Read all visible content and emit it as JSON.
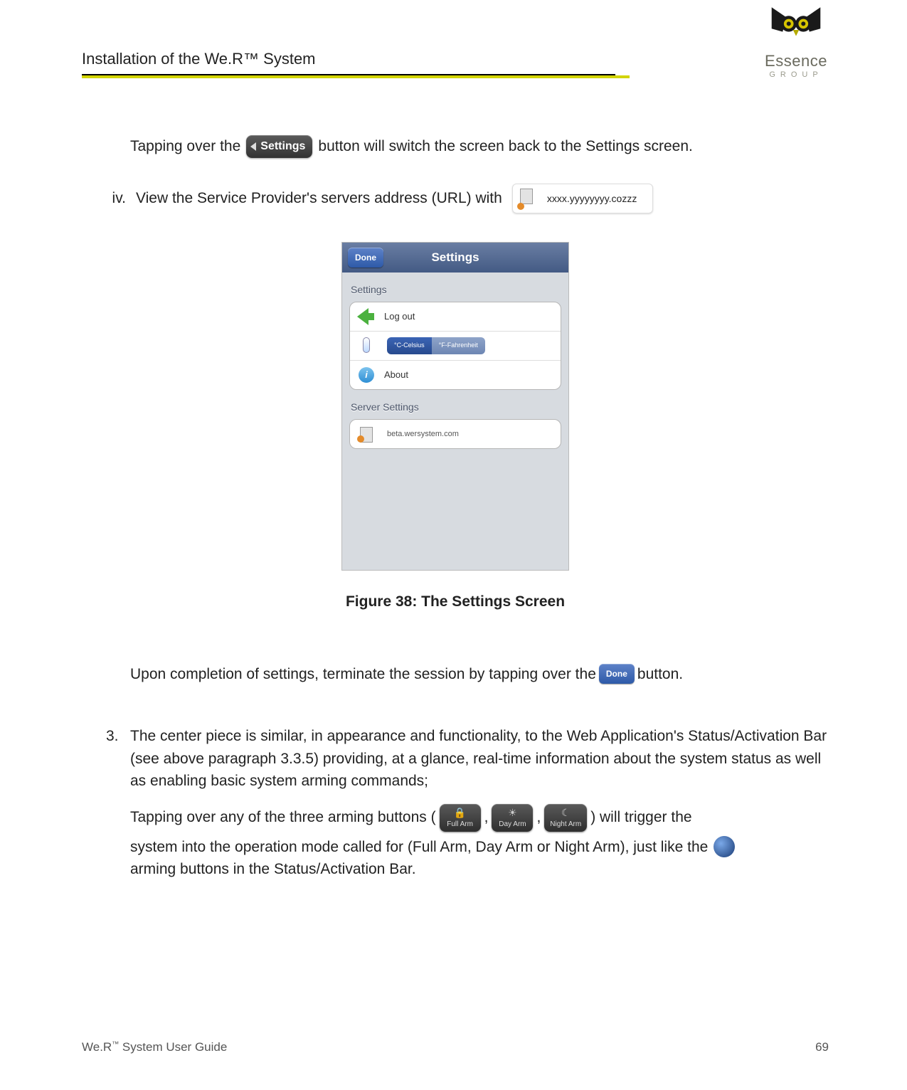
{
  "header": {
    "title": "Installation of the We.R™ System",
    "logo_text": "Essence",
    "logo_sub": "GROUP"
  },
  "body": {
    "line1_a": "Tapping over the",
    "settings_pill": "Settings",
    "line1_b": "button will switch the screen back to the Settings screen.",
    "iv_label": "iv.",
    "iv_text": "View the Service Provider's servers address (URL) with",
    "url_chip": "xxxx.yyyyyyyy.cozzz",
    "figure_caption": "Figure 38: The Settings Screen",
    "upon_a": "Upon completion of settings, terminate the session by tapping over the",
    "done_label": "Done",
    "upon_b": "button.",
    "item3_num": "3.",
    "item3_p1": "The center piece is similar, in appearance and functionality, to the Web Application's Status/Activation Bar (see above paragraph 3.3.5) providing, at a glance, real-time information about the system status as well as enabling basic system arming commands;",
    "item3_p2a": "Tapping over any of the three arming buttons (",
    "full_arm": "Full Arm",
    "day_arm": "Day Arm",
    "night_arm": "Night Arm",
    "item3_p2b": ") will trigger the",
    "item3_p3": "system into the operation mode called for (Full Arm, Day Arm or Night Arm), just like the",
    "item3_p4": "arming buttons in the Status/Activation Bar."
  },
  "phone": {
    "title": "Settings",
    "done": "Done",
    "section_settings": "Settings",
    "logout": "Log out",
    "celsius": "°C-Celsius",
    "fahrenheit": "°F-Fahrenheit",
    "about": "About",
    "section_server": "Server Settings",
    "server_value": "beta.wersystem.com"
  },
  "footer": {
    "left_a": "We.R",
    "left_tm": "™",
    "left_b": " System User Guide",
    "page": "69"
  }
}
